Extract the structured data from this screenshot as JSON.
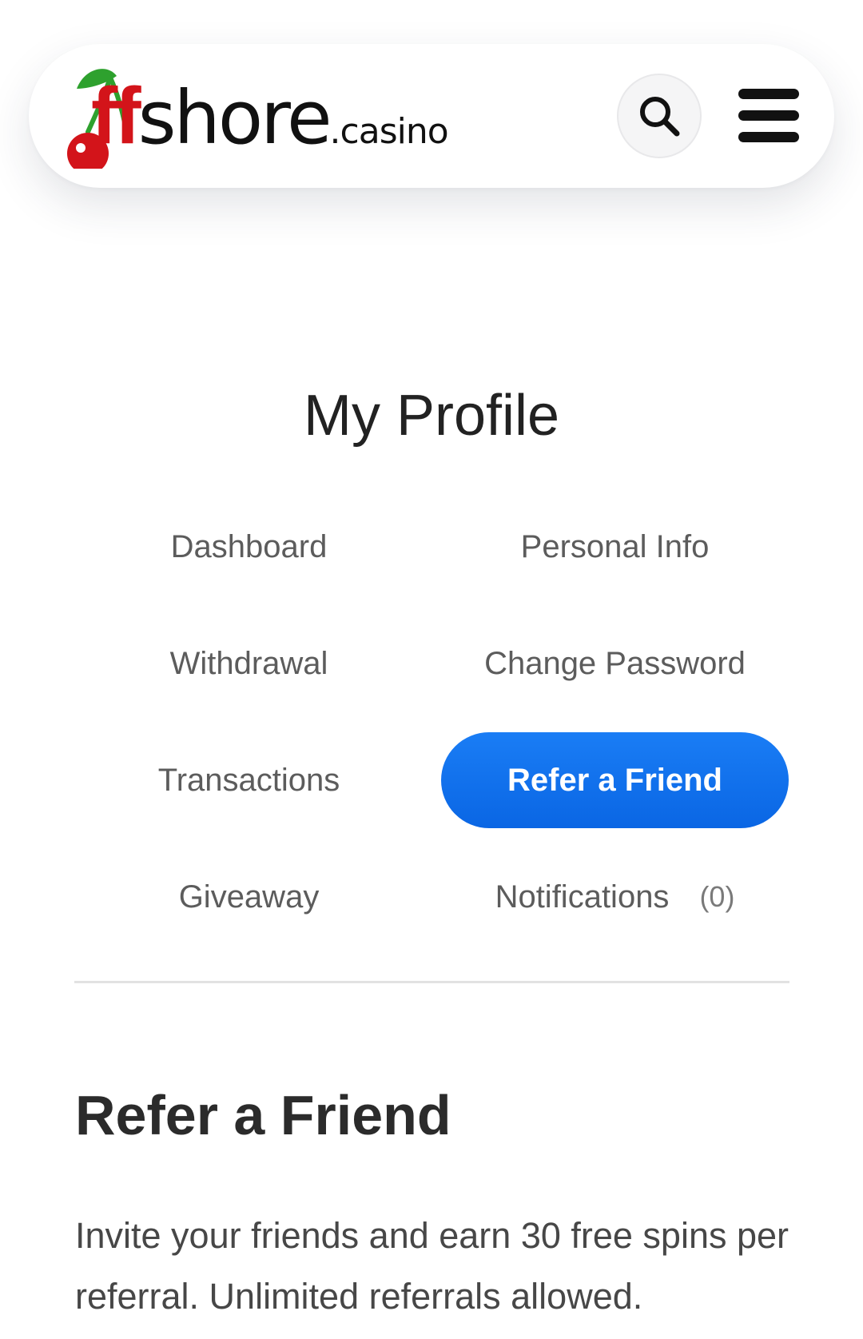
{
  "header": {
    "logo": {
      "brand_accent": "ff",
      "brand_main": "shore",
      "brand_suffix": ".casino",
      "icon": "cherry-icon",
      "accent_color": "#d3141a",
      "leaf_color": "#2ea12e"
    },
    "search_icon": "search-icon",
    "menu_icon": "hamburger-menu-icon"
  },
  "profile": {
    "title": "My Profile",
    "nav": [
      {
        "label": "Dashboard",
        "active": false
      },
      {
        "label": "Personal Info",
        "active": false
      },
      {
        "label": "Withdrawal",
        "active": false
      },
      {
        "label": "Change Password",
        "active": false
      },
      {
        "label": "Transactions",
        "active": false
      },
      {
        "label": "Refer a Friend",
        "active": true
      },
      {
        "label": "Giveaway",
        "active": false
      },
      {
        "label": "Notifications",
        "count": "(0)",
        "active": false
      }
    ],
    "active_color": "#0f6fec"
  },
  "content": {
    "title": "Refer a Friend",
    "description": "Invite your friends and earn 30 free spins per referral. Unlimited referrals allowed."
  }
}
